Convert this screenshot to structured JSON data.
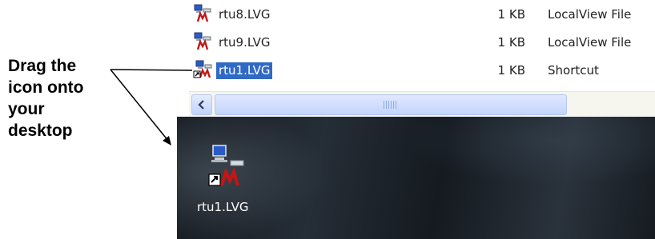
{
  "annotation": {
    "lines": [
      "Drag the",
      "icon onto",
      "your",
      "desktop"
    ]
  },
  "file_list": {
    "rows": [
      {
        "name": "rtu8.LVG",
        "size": "1 KB",
        "type": "LocalView File",
        "selected": false
      },
      {
        "name": "rtu9.LVG",
        "size": "1 KB",
        "type": "LocalView File",
        "selected": false
      },
      {
        "name": "rtu1.LVG",
        "size": "1 KB",
        "type": "Shortcut",
        "selected": true
      }
    ],
    "icon": "localview-file-icon"
  },
  "scrollbar": {
    "left_arrow_icon": "chevron-left-icon"
  },
  "desktop": {
    "shortcut_label": "rtu1.LVG",
    "icon": "localview-shortcut-icon"
  },
  "colors": {
    "selection": "#316ac5",
    "desktop_bg": "#1c2229"
  }
}
